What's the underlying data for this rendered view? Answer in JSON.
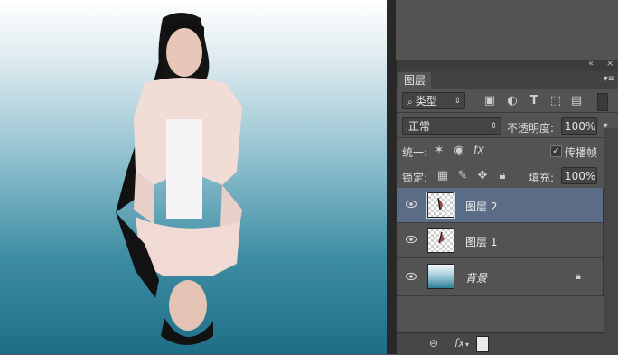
{
  "panel": {
    "tab_label": "图层",
    "filter": {
      "kind_label": "类型"
    },
    "blend_mode": "正常",
    "opacity": {
      "label": "不透明度:",
      "value": "100%"
    },
    "unify": {
      "label": "统一:",
      "propagate_label": "传播帧",
      "propagate_value": "1"
    },
    "lock": {
      "label": "锁定:"
    },
    "fill": {
      "label": "填充:",
      "value": "100%"
    },
    "bottom": {
      "fx_label": "fx"
    }
  },
  "layers": [
    {
      "name": "图层 2",
      "selected": true
    },
    {
      "name": "图层 1",
      "selected": false
    },
    {
      "name": "背景",
      "selected": false,
      "locked": true
    }
  ],
  "colors": {
    "selected_row": "#5b6d86",
    "panel_bg": "#535353"
  }
}
